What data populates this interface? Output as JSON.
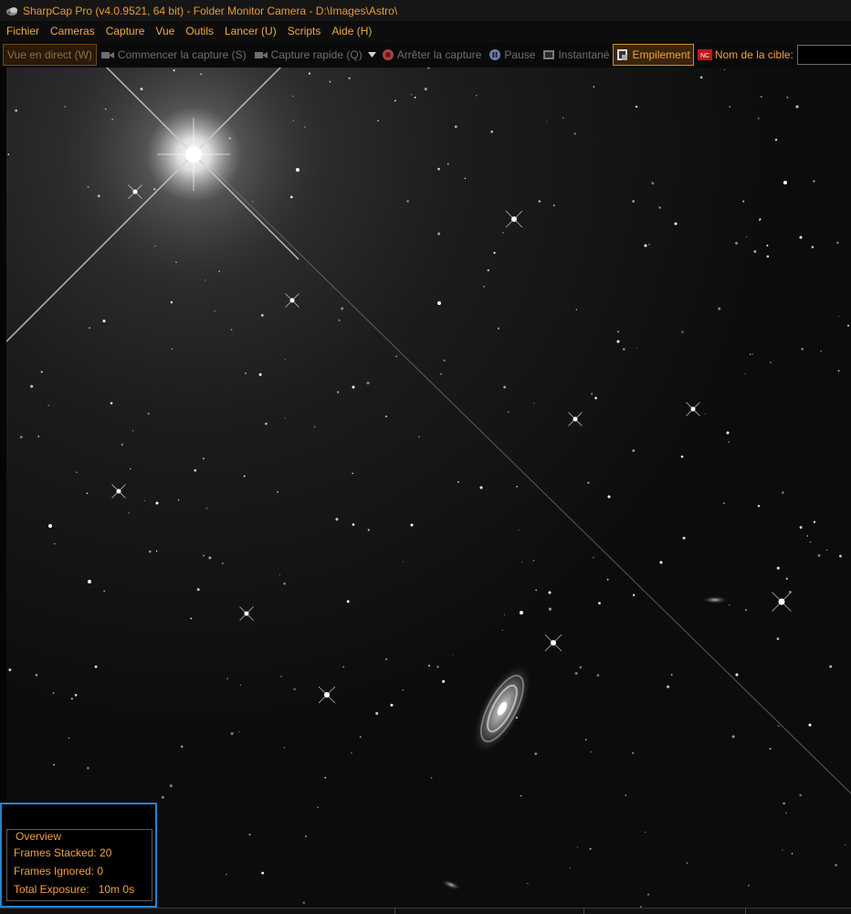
{
  "window": {
    "title": "SharpCap Pro (v4.0.9521, 64 bit) - Folder Monitor Camera - D:\\Images\\Astro\\"
  },
  "menu": [
    "Fichier",
    "Cameras",
    "Capture",
    "Vue",
    "Outils",
    "Lancer (U)",
    "Scripts",
    "Aide (H)"
  ],
  "toolbar": {
    "live_view": "Vue en direct (W)",
    "start_capture": "Commencer la capture (S)",
    "quick_capture": "Capture rapide (Q)",
    "stop_capture": "Arrêter la capture",
    "pause": "Pause",
    "snapshot": "Instantané",
    "stacking": "Empilement",
    "target_label": "Nom de la cible:",
    "target_value": ""
  },
  "overview": {
    "title": "Overview",
    "frames_stacked": "Frames Stacked: 20",
    "frames_ignored": "Frames Ignored: 0",
    "total_exposure": "Total Exposure:   10m 0s"
  },
  "colors": {
    "accent": "#f0a040",
    "highlight_border": "#1f84d6",
    "background": "#000000"
  }
}
